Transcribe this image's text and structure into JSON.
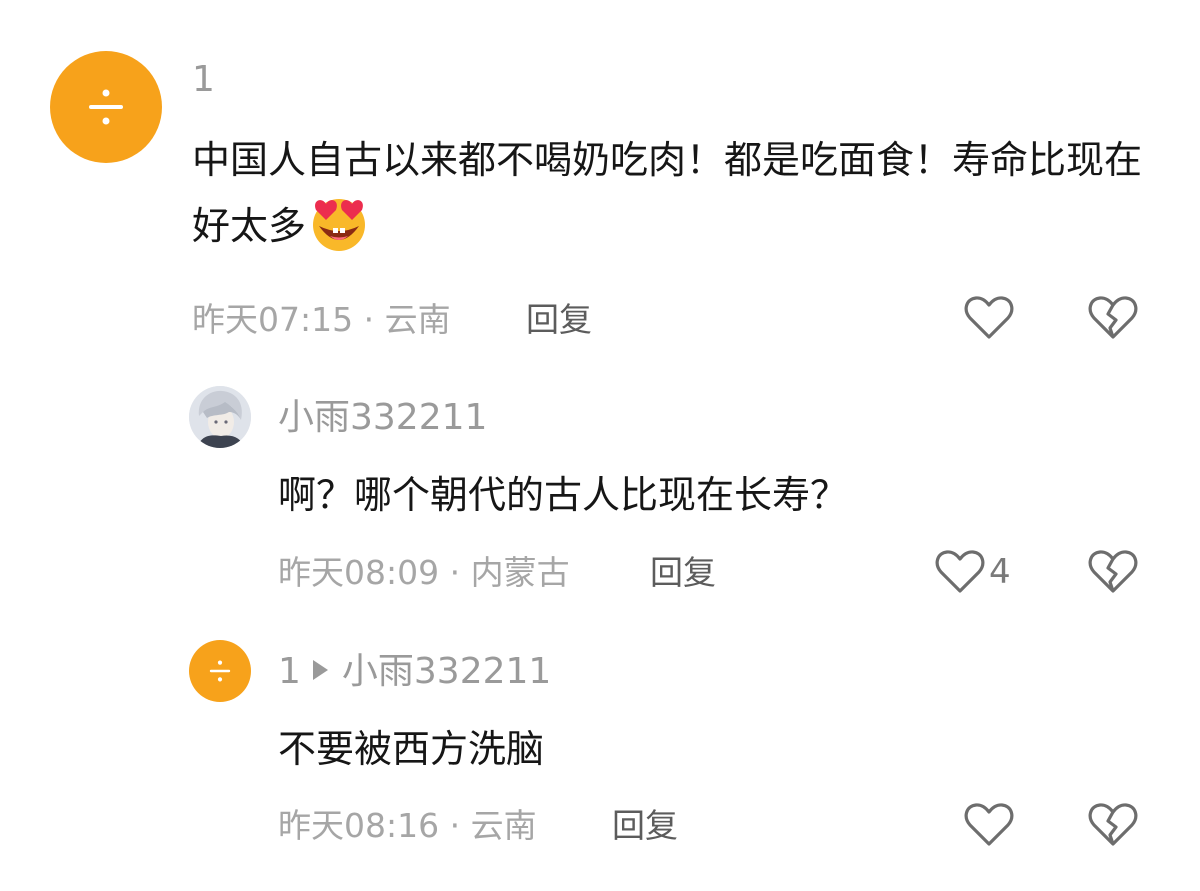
{
  "comments": [
    {
      "user": "1",
      "text": "中国人自古以来都不喝奶吃肉！都是吃面食！寿命比现在好太多",
      "emoji": "heart-eyes-emoji",
      "time": "昨天07:15",
      "location": "云南",
      "reply_label": "回复",
      "likes": ""
    },
    {
      "user": "小雨332211",
      "text": "啊？哪个朝代的古人比现在长寿？",
      "time": "昨天08:09",
      "location": "内蒙古",
      "reply_label": "回复",
      "likes": "4"
    },
    {
      "user": "1",
      "reply_to": "小雨332211",
      "text": "不要被西方洗脑",
      "time": "昨天08:16",
      "location": "云南",
      "reply_label": "回复",
      "likes": ""
    }
  ],
  "separator": "·",
  "colors": {
    "avatar_orange": "#f7a21b",
    "name": "#9a9a9a",
    "body": "#161616",
    "meta": "#a6a6a6"
  },
  "icons": [
    "divide-icon",
    "heart-outline-icon",
    "broken-heart-icon",
    "triangle-right-icon"
  ]
}
